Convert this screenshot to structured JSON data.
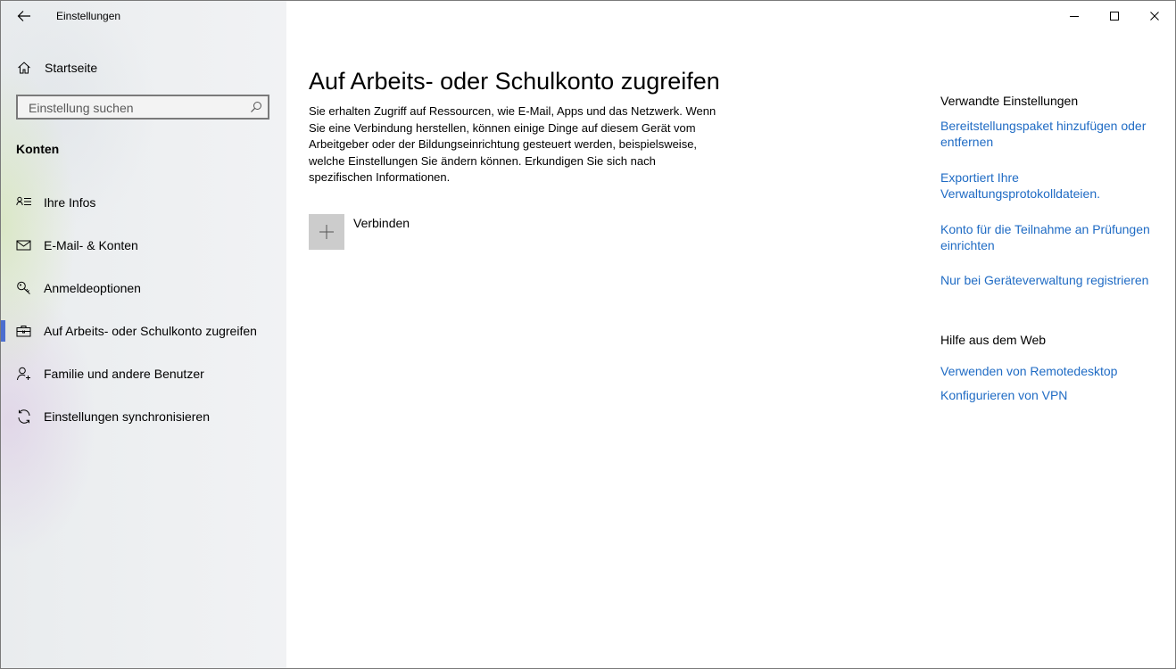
{
  "window": {
    "app_title": "Einstellungen",
    "controls": [
      "minimize-icon",
      "maximize-icon",
      "close-icon"
    ]
  },
  "sidebar": {
    "home_label": "Startseite",
    "search": {
      "placeholder": "Einstellung suchen",
      "value": ""
    },
    "section_title": "Konten",
    "items": [
      {
        "label": "Ihre Infos",
        "icon": "contact-card-icon",
        "selected": false
      },
      {
        "label": "E-Mail- & Konten",
        "icon": "mail-icon",
        "selected": false
      },
      {
        "label": "Anmeldeoptionen",
        "icon": "key-icon",
        "selected": false
      },
      {
        "label": "Auf Arbeits- oder Schulkonto zugreifen",
        "icon": "briefcase-icon",
        "selected": true
      },
      {
        "label": "Familie und andere Benutzer",
        "icon": "person-add-icon",
        "selected": false
      },
      {
        "label": "Einstellungen synchronisieren",
        "icon": "sync-icon",
        "selected": false
      }
    ],
    "accent": "#4c6ecf"
  },
  "main": {
    "title": "Auf Arbeits- oder Schulkonto zugreifen",
    "description": "Sie erhalten Zugriff auf Ressourcen, wie E-Mail, Apps und das Netzwerk. Wenn Sie eine Verbindung herstellen, können einige Dinge auf diesem Gerät vom Arbeitgeber oder der Bildungseinrichtung gesteuert werden, beispielsweise, welche Einstellungen Sie ändern können. Erkundigen Sie sich nach spezifischen Informationen.",
    "connect_label": "Verbinden"
  },
  "related": {
    "heading": "Verwandte Einstellungen",
    "links": [
      "Bereitstellungspaket hinzufügen oder entfernen",
      "Exportiert Ihre Verwaltungsprotokolldateien.",
      "Konto für die Teilnahme an Prüfungen einrichten",
      "Nur bei Geräteverwaltung registrieren"
    ]
  },
  "help": {
    "heading": "Hilfe aus dem Web",
    "links": [
      "Verwenden von Remotedesktop",
      "Konfigurieren von VPN"
    ]
  },
  "colors": {
    "link": "#1f6bc4",
    "tile": "#cccccc"
  }
}
